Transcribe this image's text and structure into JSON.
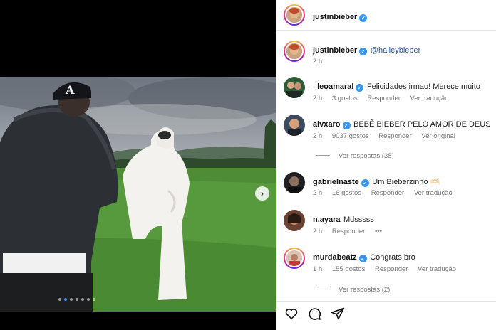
{
  "post": {
    "author": "justinbieber",
    "author_verified": true
  },
  "caption": {
    "username": "justinbieber",
    "mention": "@haileybieber",
    "time": "2 h"
  },
  "comments": [
    {
      "username": "_leoamaral",
      "verified": true,
      "text": "Felicidades irmao! Merece muito",
      "time": "2 h",
      "likes": "3 gostos",
      "actions": [
        "Responder",
        "Ver tradução"
      ]
    },
    {
      "username": "alvxaro",
      "verified": true,
      "text": "BEBÊ BIEBER PELO AMOR DE DEUS",
      "time": "2 h",
      "likes": "9037 gostos",
      "actions": [
        "Responder",
        "Ver original"
      ],
      "replies": "Ver respostas (38)"
    },
    {
      "username": "gabrielnaste",
      "verified": true,
      "text": "Um Bieberzinho 🫶🏻",
      "time": "2 h",
      "likes": "16 gostos",
      "actions": [
        "Responder",
        "Ver tradução"
      ]
    },
    {
      "username": "n.ayara",
      "verified": false,
      "text": "Mdsssss",
      "time": "2 h",
      "likes": "",
      "actions": [
        "Responder",
        "•••"
      ]
    },
    {
      "username": "murdabeatz",
      "verified": true,
      "text": "Congrats bro",
      "time": "1 h",
      "likes": "155 gostos",
      "actions": [
        "Responder",
        "Ver tradução"
      ],
      "replies": "Ver respostas (2)"
    }
  ],
  "carousel": {
    "count": 7,
    "active": 1
  },
  "icons": {
    "like": "heart-icon",
    "comment": "comment-icon",
    "share": "send-icon",
    "next": "chevron-right-icon"
  },
  "colors": {
    "verified": "#3897f0",
    "mention": "#2d5a97",
    "active_dot": "#4d8fe8"
  }
}
